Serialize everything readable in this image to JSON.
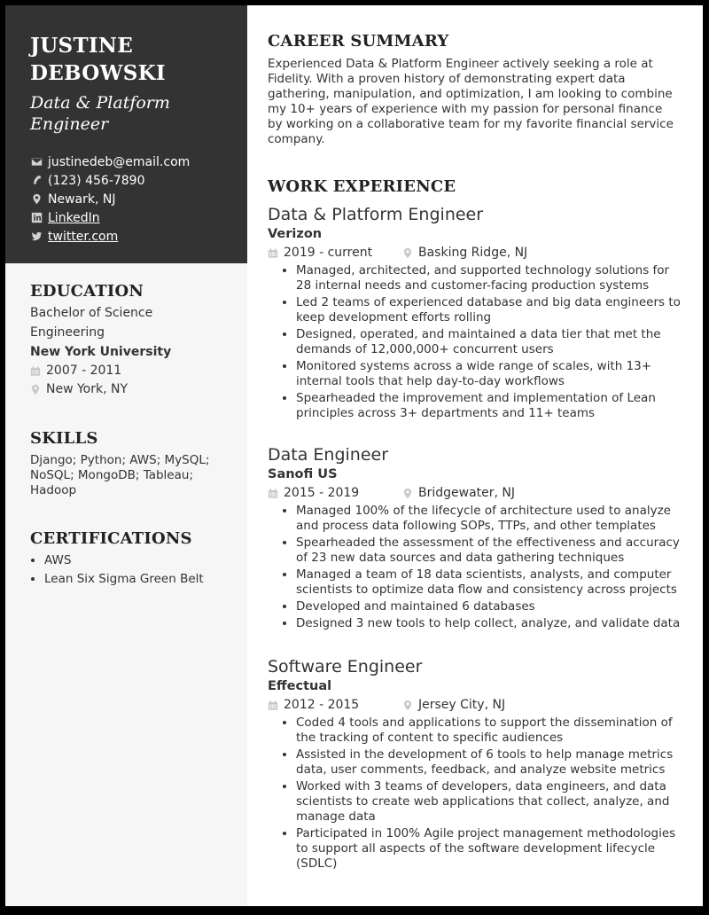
{
  "header": {
    "name_line1": "JUSTINE",
    "name_line2": "DEBOWSKI",
    "role_line1": "Data & Platform",
    "role_line2": "Engineer"
  },
  "contact": {
    "email": "justinedeb@email.com",
    "phone": "(123) 456-7890",
    "location": "Newark, NJ",
    "linkedin": "LinkedIn",
    "twitter": "twitter.com"
  },
  "education": {
    "title": "EDUCATION",
    "degree_line1": "Bachelor of Science",
    "degree_line2": "Engineering",
    "school": "New York University",
    "dates": "2007 - 2011",
    "location": "New York, NY"
  },
  "skills": {
    "title": "SKILLS",
    "text": "Django; Python; AWS; MySQL; NoSQL; MongoDB; Tableau; Hadoop"
  },
  "certifications": {
    "title": "CERTIFICATIONS",
    "items": [
      "AWS",
      "Lean Six Sigma Green Belt"
    ]
  },
  "summary": {
    "title": "CAREER SUMMARY",
    "text": "Experienced Data & Platform Engineer actively seeking a role at Fidelity. With a proven history of demonstrating expert data gathering, manipulation, and optimization, I am looking to combine my 10+ years of experience with my passion for personal finance by working on a collaborative team for my favorite financial service company."
  },
  "experience": {
    "title": "WORK EXPERIENCE",
    "jobs": [
      {
        "title": "Data & Platform Engineer",
        "company": "Verizon",
        "dates": "2019 - current",
        "location": "Basking Ridge, NJ",
        "bullets": [
          "Managed, architected, and supported technology solutions for 28 internal needs and customer-facing production systems",
          "Led 2 teams of experienced database and big data engineers to keep development efforts rolling",
          "Designed, operated, and maintained a data tier that met the demands of 12,000,000+ concurrent users",
          "Monitored systems across a wide range of scales, with 13+ internal tools that help day-to-day workflows",
          "Spearheaded the improvement and implementation of Lean principles across 3+ departments and 11+ teams"
        ]
      },
      {
        "title": "Data Engineer",
        "company": "Sanofi US",
        "dates": "2015 - 2019",
        "location": "Bridgewater, NJ",
        "bullets": [
          "Managed 100% of the lifecycle of architecture used to analyze and process data following SOPs, TTPs, and other templates",
          "Spearheaded the assessment of the effectiveness and accuracy of 23 new data sources and data gathering techniques",
          "Managed a team of 18 data scientists, analysts, and computer scientists to optimize data flow and consistency across projects",
          "Developed and maintained 6 databases",
          "Designed 3 new tools to help collect, analyze, and validate data"
        ]
      },
      {
        "title": "Software Engineer",
        "company": "Effectual",
        "dates": "2012 - 2015",
        "location": "Jersey City, NJ",
        "bullets": [
          "Coded 4 tools and applications to support the dissemination of the tracking of content to specific audiences",
          "Assisted in the development of 6 tools to help manage metrics data, user comments, feedback, and analyze website metrics",
          "Worked with 3 teams of developers, data engineers, and data scientists to create web applications that collect, analyze, and manage data",
          "Participated in 100% Agile project management methodologies to support all aspects of the software development lifecycle (SDLC)"
        ]
      }
    ]
  }
}
